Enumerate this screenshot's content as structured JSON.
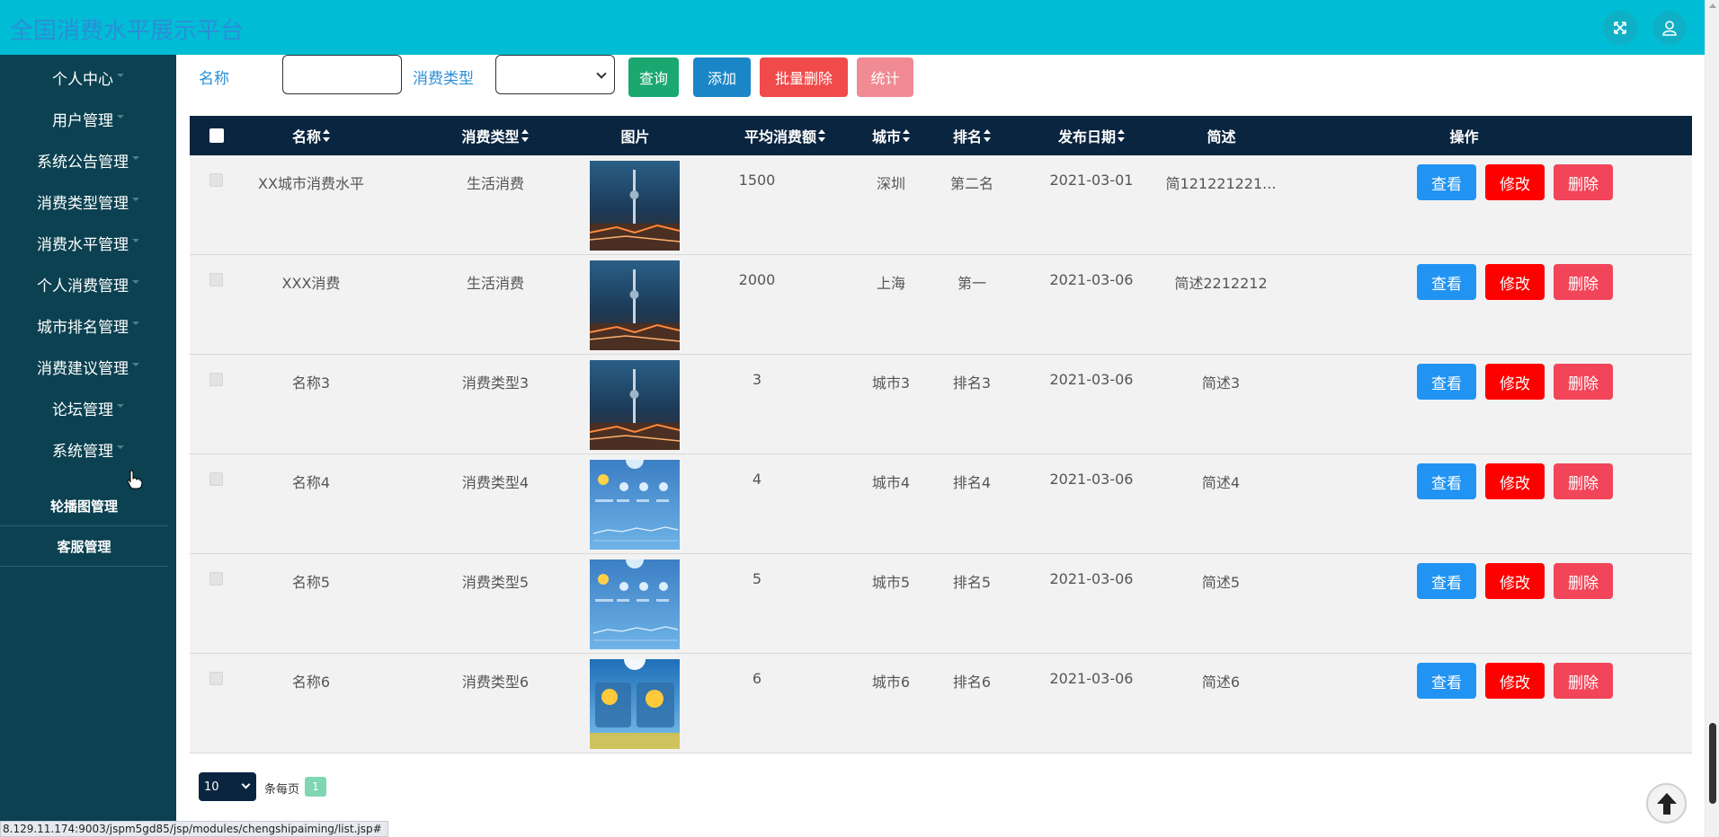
{
  "app": {
    "title": "全国消费水平展示平台"
  },
  "header": {
    "fullscreen_icon": "fullscreen-icon",
    "user_icon": "user-icon"
  },
  "sidebar": {
    "items": [
      {
        "label": "个人中心"
      },
      {
        "label": "用户管理"
      },
      {
        "label": "系统公告管理"
      },
      {
        "label": "消费类型管理"
      },
      {
        "label": "消费水平管理"
      },
      {
        "label": "个人消费管理"
      },
      {
        "label": "城市排名管理"
      },
      {
        "label": "消费建议管理"
      },
      {
        "label": "论坛管理"
      },
      {
        "label": "系统管理"
      }
    ],
    "subitems": [
      {
        "label": "轮播图管理"
      },
      {
        "label": "客服管理"
      }
    ]
  },
  "search": {
    "name_label": "名称",
    "name_value": "",
    "type_label": "消费类型",
    "type_value": "",
    "query_label": "查询",
    "add_label": "添加",
    "batch_delete_label": "批量删除",
    "stats_label": "统计"
  },
  "table": {
    "columns": [
      "名称",
      "消费类型",
      "图片",
      "平均消费额",
      "城市",
      "排名",
      "发布日期",
      "简述",
      "操作"
    ],
    "rows": [
      {
        "name": "XX城市消费水平",
        "type": "生活消费",
        "image": "city-night",
        "avg": "1500",
        "city": "深圳",
        "rank": "第二名",
        "date": "2021-03-01",
        "desc": "简121221221..."
      },
      {
        "name": "XXX消费",
        "type": "生活消费",
        "image": "city-night",
        "avg": "2000",
        "city": "上海",
        "rank": "第一",
        "date": "2021-03-06",
        "desc": "简述2212212"
      },
      {
        "name": "名称3",
        "type": "消费类型3",
        "image": "city-night",
        "avg": "3",
        "city": "城市3",
        "rank": "排名3",
        "date": "2021-03-06",
        "desc": "简述3"
      },
      {
        "name": "名称4",
        "type": "消费类型4",
        "image": "weather-app",
        "avg": "4",
        "city": "城市4",
        "rank": "排名4",
        "date": "2021-03-06",
        "desc": "简述4"
      },
      {
        "name": "名称5",
        "type": "消费类型5",
        "image": "weather-app",
        "avg": "5",
        "city": "城市5",
        "rank": "排名5",
        "date": "2021-03-06",
        "desc": "简述5"
      },
      {
        "name": "名称6",
        "type": "消费类型6",
        "image": "weather-sun",
        "avg": "6",
        "city": "城市6",
        "rank": "排名6",
        "date": "2021-03-06",
        "desc": "简述6"
      }
    ],
    "actions": {
      "view": "查看",
      "edit": "修改",
      "delete": "删除"
    }
  },
  "pagination": {
    "page_size": "10",
    "per_page_label": "条每页",
    "current_page": "1"
  },
  "status_bar": {
    "url": "8.129.11.174:9003/jspm5gd85/jsp/modules/chengshipaiming/list.jsp#"
  },
  "colors": {
    "header": "#00bcd4",
    "sidebar": "#0b4151",
    "table_header": "#0a2540",
    "btn_query": "#1aa870",
    "btn_add": "#1a86c8",
    "btn_batch_delete": "#f04a4a",
    "btn_stats": "#f08a93",
    "btn_view": "#2194f3",
    "btn_edit": "#ff0000",
    "btn_delete": "#f24559"
  }
}
